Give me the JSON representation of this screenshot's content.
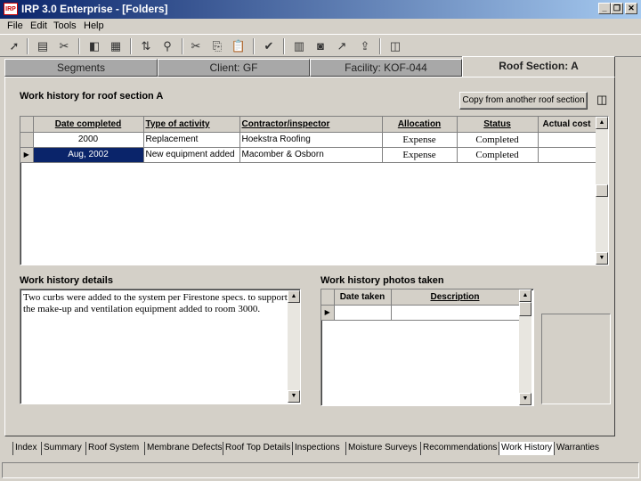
{
  "window": {
    "title": "IRP 3.0 Enterprise - [Folders]",
    "app_icon": "IRP"
  },
  "menu": [
    "File",
    "Edit",
    "Tools",
    "Help"
  ],
  "top_tabs": [
    "Segments",
    "Client: GF",
    "Facility: KOF-044",
    "Roof Section: A"
  ],
  "section_title": "Work history for roof section A",
  "copy_button": "Copy from another roof section",
  "history_grid": {
    "columns": [
      "Date completed",
      "Type of activity",
      "Contractor/inspector",
      "Allocation",
      "Status",
      "Actual cost"
    ],
    "rows": [
      [
        "2000",
        "Replacement",
        "Hoekstra Roofing",
        "Expense",
        "Completed",
        ""
      ],
      [
        "Aug, 2002",
        "New equipment added",
        "Macomber & Osborn",
        "Expense",
        "Completed",
        ""
      ]
    ]
  },
  "details": {
    "label": "Work history details",
    "text": "Two curbs were added to the system per Firestone specs. to support the make-up and ventilation equipment added to room 3000."
  },
  "photos": {
    "label": "Work history photos taken",
    "columns": [
      "Date taken",
      "Description"
    ]
  },
  "bottom_tabs": [
    "Index",
    "Summary",
    "Roof System",
    "Membrane Defects",
    "Roof Top Details",
    "Inspections",
    "Moisture Surveys",
    "Recommendations",
    "Work History",
    "Warranties"
  ],
  "active_bottom_tab": "Work History"
}
